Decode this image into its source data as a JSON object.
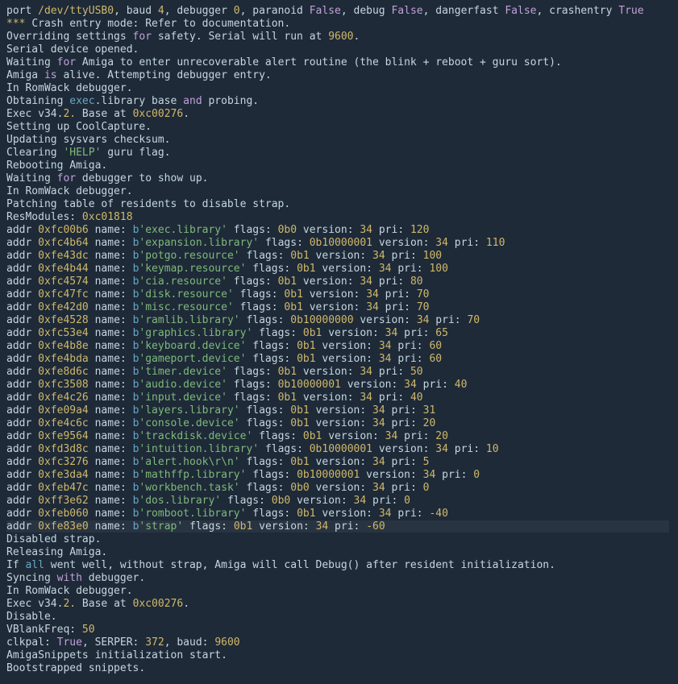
{
  "header": {
    "port_path": "/dev/ttyUSB0",
    "baud_short": "4",
    "debugger_n": "0",
    "paranoid": "False",
    "debug": "False",
    "dangerfast": "False",
    "crashentry": "True"
  },
  "crash_mode": "*** Crash entry mode: Refer to documentation.",
  "override_baud": "9600",
  "opened": "Serial device opened.",
  "wait1": "Waiting ",
  "wait_kw": "for",
  "wait2": " Amiga to enter unrecoverable alert routine (the blink + reboot + guru sort).",
  "alive1": "Amiga ",
  "alive_kw": "is",
  "alive2": " alive. Attempting debugger entry.",
  "romwack": "In RomWack debugger.",
  "obtain1": "Obtaining ",
  "obtain_exec": "exec",
  "obtain2": ".library base ",
  "obtain_and": "and",
  "obtain3": " probing.",
  "exec_ver_prefix": "Exec v34.",
  "exec_ver_num": "2.",
  "exec_base_txt": " Base at ",
  "exec_base_hex": "0xc00276",
  "coolcapture": "Setting up CoolCapture.",
  "sysvars": "Updating sysvars checksum.",
  "clearing1": "Clearing ",
  "help_flag": "'HELP'",
  "clearing2": " guru flag.",
  "reboot": "Rebooting Amiga.",
  "wait_dbg1": "Waiting ",
  "wait_dbg2": " debugger to show up.",
  "patch": "Patching table of residents to disable strap.",
  "resmodules_label": "ResModules: ",
  "resmodules_hex": "0xc01818",
  "residents": [
    {
      "addr": "0xfc00b6",
      "name": "'exec.library'",
      "flags": "0b0",
      "version": "34",
      "pri": "120"
    },
    {
      "addr": "0xfc4b64",
      "name": "'expansion.library'",
      "flags": "0b10000001",
      "version": "34",
      "pri": "110"
    },
    {
      "addr": "0xfe43dc",
      "name": "'potgo.resource'",
      "flags": "0b1",
      "version": "34",
      "pri": "100"
    },
    {
      "addr": "0xfe4b44",
      "name": "'keymap.resource'",
      "flags": "0b1",
      "version": "34",
      "pri": "100"
    },
    {
      "addr": "0xfc4574",
      "name": "'cia.resource'",
      "flags": "0b1",
      "version": "34",
      "pri": "80"
    },
    {
      "addr": "0xfc47fc",
      "name": "'disk.resource'",
      "flags": "0b1",
      "version": "34",
      "pri": "70"
    },
    {
      "addr": "0xfe42d0",
      "name": "'misc.resource'",
      "flags": "0b1",
      "version": "34",
      "pri": "70"
    },
    {
      "addr": "0xfe4528",
      "name": "'ramlib.library'",
      "flags": "0b10000000",
      "version": "34",
      "pri": "70"
    },
    {
      "addr": "0xfc53e4",
      "name": "'graphics.library'",
      "flags": "0b1",
      "version": "34",
      "pri": "65"
    },
    {
      "addr": "0xfe4b8e",
      "name": "'keyboard.device'",
      "flags": "0b1",
      "version": "34",
      "pri": "60"
    },
    {
      "addr": "0xfe4bda",
      "name": "'gameport.device'",
      "flags": "0b1",
      "version": "34",
      "pri": "60"
    },
    {
      "addr": "0xfe8d6c",
      "name": "'timer.device'",
      "flags": "0b1",
      "version": "34",
      "pri": "50"
    },
    {
      "addr": "0xfc3508",
      "name": "'audio.device'",
      "flags": "0b10000001",
      "version": "34",
      "pri": "40"
    },
    {
      "addr": "0xfe4c26",
      "name": "'input.device'",
      "flags": "0b1",
      "version": "34",
      "pri": "40"
    },
    {
      "addr": "0xfe09a4",
      "name": "'layers.library'",
      "flags": "0b1",
      "version": "34",
      "pri": "31"
    },
    {
      "addr": "0xfe4c6c",
      "name": "'console.device'",
      "flags": "0b1",
      "version": "34",
      "pri": "20"
    },
    {
      "addr": "0xfe9564",
      "name": "'trackdisk.device'",
      "flags": "0b1",
      "version": "34",
      "pri": "20"
    },
    {
      "addr": "0xfd3d8c",
      "name": "'intuition.library'",
      "flags": "0b10000001",
      "version": "34",
      "pri": "10"
    },
    {
      "addr": "0xfc3276",
      "name": "'alert.hook\\r\\n'",
      "flags": "0b1",
      "version": "34",
      "pri": "5"
    },
    {
      "addr": "0xfe3da4",
      "name": "'mathffp.library'",
      "flags": "0b10000001",
      "version": "34",
      "pri": "0"
    },
    {
      "addr": "0xfeb47c",
      "name": "'workbench.task'",
      "flags": "0b0",
      "version": "34",
      "pri": "0"
    },
    {
      "addr": "0xff3e62",
      "name": "'dos.library'",
      "flags": "0b0",
      "version": "34",
      "pri": "0"
    },
    {
      "addr": "0xfeb060",
      "name": "'romboot.library'",
      "flags": "0b1",
      "version": "34",
      "pri": "-40"
    },
    {
      "addr": "0xfe83e0",
      "name": "'strap'",
      "flags": "0b1",
      "version": "34",
      "pri": "-60",
      "highlight": true
    }
  ],
  "disabled": "Disabled strap.",
  "releasing": "Releasing Amiga.",
  "ifall1": "If ",
  "ifall_kw": "all",
  "ifall2": " went well, without strap, Amiga will call Debug() after resident initialization.",
  "syncing1": "Syncing ",
  "syncing_kw": "with",
  "syncing2": " debugger.",
  "disable": "Disable.",
  "vblank_label": "VBlankFreq: ",
  "vblank_val": "50",
  "clkpal_label": "clkpal: ",
  "clkpal_val": "True",
  "serper_label": ", SERPER: ",
  "serper_val": "372",
  "baud_label": ", baud: ",
  "baud_val": "9600",
  "snippets_init": "AmigaSnippets initialization start.",
  "bootstrapped": "Bootstrapped snippets."
}
